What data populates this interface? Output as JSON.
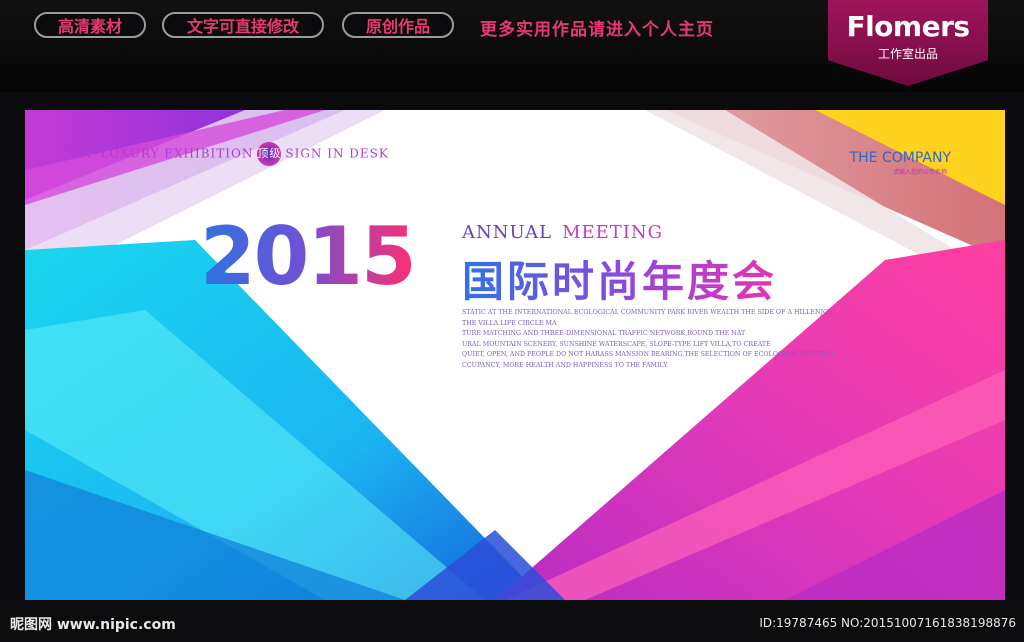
{
  "top_bar": {
    "pills": [
      "高清素材",
      "文字可直接修改",
      "原创作品"
    ],
    "more": "更多实用作品请进入个人主页",
    "brand_name": "Flomers",
    "brand_sub": "工作室出品"
  },
  "poster": {
    "tagline_pre": "Top luxury exhibition",
    "badge": "顶级",
    "tagline_post": "Sign in desk",
    "company": "THE COMPANY",
    "company_sub": "请输入您的公司名称",
    "year": "2015",
    "annual": "Annual",
    "meeting": "meeting",
    "title_cn": "国际时尚年度会",
    "desc_lines": [
      "STATIC AT THE INTERNATIONAL ECOLOGICAL COMMUNITY PARK RIVER WEALTH THE SIDE OF A HILLENJOY",
      "THE VILLA LIFE CIRCLE MA",
      "TURE MATCHING AND THREE-DIMENSIONAL TRAFFIC NETWORK,ROUND THE NAT",
      "URAL MOUNTAIN SCENERY, SUNSHINE WATERSCAPE, SLOPE-TYPE LIFT VILLA,TO CREATE",
      "QUIET, OPEN, AND PEOPLE DO NOT HARASS MANSION BEARING,THE SELECTION OF ECOLOGICAL HOUSE O",
      "CCUPANCY, MORE HEALTH AND HAPPINESS TO THE FAMILY."
    ]
  },
  "bottom_bar": {
    "site": "昵图网 www.nipic.com",
    "id_text": "ID:19787465 NO:20151007161838198876"
  },
  "colors": {
    "accent_pink": "#e43a71",
    "brand_bg": "#a0155b",
    "cyan": "#22d8ee",
    "magenta": "#e23ab8",
    "purple": "#a62ad6",
    "yellow": "#ffd21e"
  }
}
